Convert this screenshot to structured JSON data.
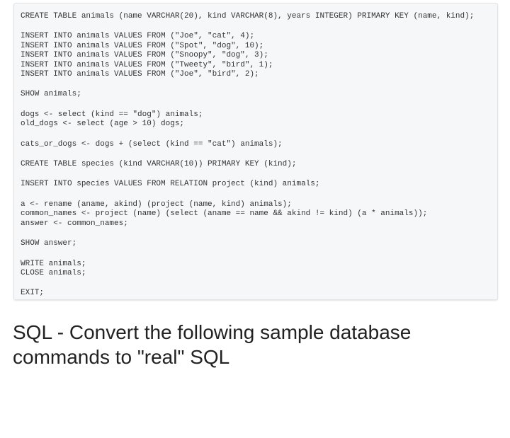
{
  "code_blocks": [
    [
      "CREATE TABLE animals (name VARCHAR(20), kind VARCHAR(8), years INTEGER) PRIMARY KEY (name, kind);"
    ],
    [
      "INSERT INTO animals VALUES FROM (\"Joe\", \"cat\", 4);",
      "INSERT INTO animals VALUES FROM (\"Spot\", \"dog\", 10);",
      "INSERT INTO animals VALUES FROM (\"Snoopy\", \"dog\", 3);",
      "INSERT INTO animals VALUES FROM (\"Tweety\", \"bird\", 1);",
      "INSERT INTO animals VALUES FROM (\"Joe\", \"bird\", 2);"
    ],
    [
      "SHOW animals;"
    ],
    [
      "dogs <- select (kind == \"dog\") animals;",
      "old_dogs <- select (age > 10) dogs;"
    ],
    [
      "cats_or_dogs <- dogs + (select (kind == \"cat\") animals);"
    ],
    [
      "CREATE TABLE species (kind VARCHAR(10)) PRIMARY KEY (kind);"
    ],
    [
      "INSERT INTO species VALUES FROM RELATION project (kind) animals;"
    ],
    [
      "a <- rename (aname, akind) (project (name, kind) animals);",
      "common_names <- project (name) (select (aname == name && akind != kind) (a * animals));",
      "answer <- common_names;"
    ],
    [
      "SHOW answer;"
    ],
    [
      "WRITE animals;",
      "CLOSE animals;"
    ],
    [
      "EXIT;"
    ]
  ],
  "caption": "SQL - Convert the following sample database commands to \"real\" SQL"
}
